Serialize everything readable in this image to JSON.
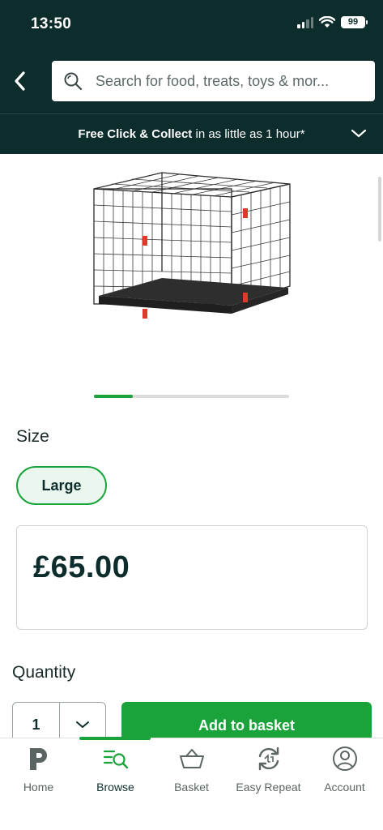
{
  "status_bar": {
    "time": "13:50",
    "battery": "99"
  },
  "header": {
    "back_label": "Back",
    "search_placeholder": "Search for food, treats, toys & mor..."
  },
  "collect_banner": {
    "bold": "Free Click & Collect",
    "rest": " in as little as 1 hour*"
  },
  "product": {
    "image_icon": "dog-crate-image",
    "carousel_progress": 0.2,
    "size_label": "Size",
    "size_selected": "Large",
    "price": "£65.00",
    "quantity_label": "Quantity",
    "quantity_value": "1",
    "add_button": "Add to basket"
  },
  "tabs": [
    {
      "label": "Home",
      "icon": "p-logo-icon"
    },
    {
      "label": "Browse",
      "icon": "browse-search-icon",
      "active": true
    },
    {
      "label": "Basket",
      "icon": "basket-icon"
    },
    {
      "label": "Easy Repeat",
      "icon": "repeat-icon"
    },
    {
      "label": "Account",
      "icon": "account-icon"
    }
  ],
  "colors": {
    "brand_dark": "#0c2d2b",
    "accent_green": "#1aa33a"
  }
}
